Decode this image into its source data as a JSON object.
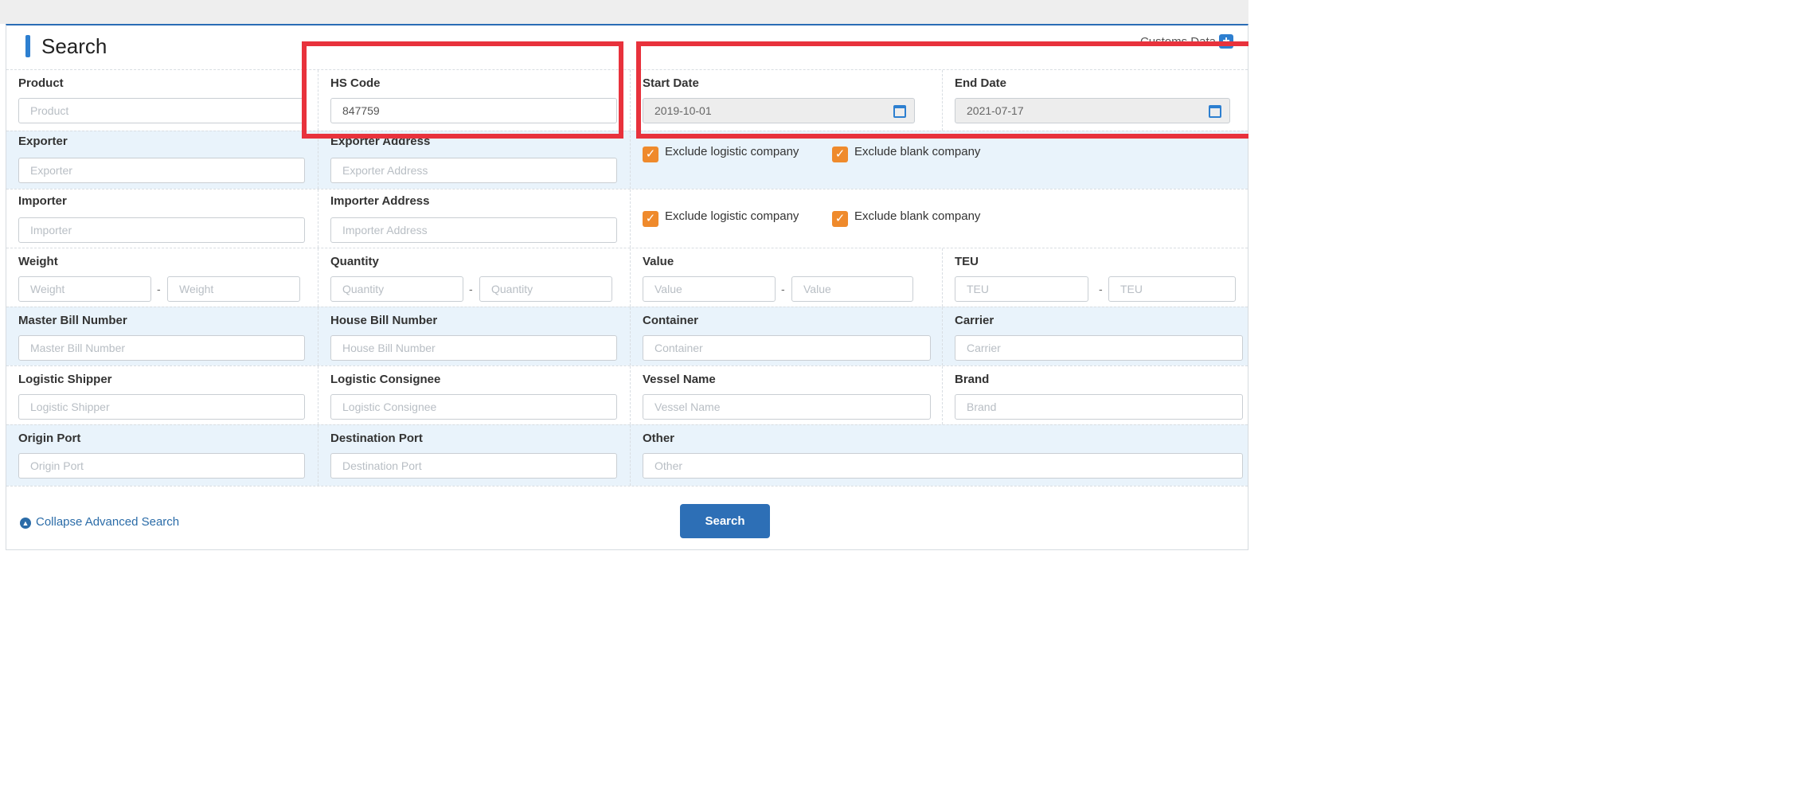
{
  "header": {
    "title": "Search",
    "customs_data": "Customs Data"
  },
  "fields": {
    "product": {
      "label": "Product",
      "placeholder": "Product"
    },
    "hs_code": {
      "label": "HS Code",
      "value": "847759"
    },
    "start_date": {
      "label": "Start Date",
      "value": "2019-10-01"
    },
    "end_date": {
      "label": "End Date",
      "value": "2021-07-17"
    },
    "exporter": {
      "label": "Exporter",
      "placeholder": "Exporter"
    },
    "exporter_address": {
      "label": "Exporter Address",
      "placeholder": "Exporter Address"
    },
    "importer": {
      "label": "Importer",
      "placeholder": "Importer"
    },
    "importer_address": {
      "label": "Importer Address",
      "placeholder": "Importer Address"
    },
    "weight": {
      "label": "Weight",
      "placeholder": "Weight"
    },
    "quantity": {
      "label": "Quantity",
      "placeholder": "Quantity"
    },
    "value": {
      "label": "Value",
      "placeholder": "Value"
    },
    "teu": {
      "label": "TEU",
      "placeholder": "TEU"
    },
    "master_bill": {
      "label": "Master Bill Number",
      "placeholder": "Master Bill Number"
    },
    "house_bill": {
      "label": "House Bill Number",
      "placeholder": "House Bill Number"
    },
    "container": {
      "label": "Container",
      "placeholder": "Container"
    },
    "carrier": {
      "label": "Carrier",
      "placeholder": "Carrier"
    },
    "logistic_shipper": {
      "label": "Logistic Shipper",
      "placeholder": "Logistic Shipper"
    },
    "logistic_consignee": {
      "label": "Logistic Consignee",
      "placeholder": "Logistic Consignee"
    },
    "vessel_name": {
      "label": "Vessel Name",
      "placeholder": "Vessel Name"
    },
    "brand": {
      "label": "Brand",
      "placeholder": "Brand"
    },
    "origin_port": {
      "label": "Origin Port",
      "placeholder": "Origin Port"
    },
    "destination_port": {
      "label": "Destination Port",
      "placeholder": "Destination Port"
    },
    "other": {
      "label": "Other",
      "placeholder": "Other"
    }
  },
  "range_separator": "-",
  "checkboxes": {
    "exclude_logistic": "Exclude logistic company",
    "exclude_blank": "Exclude blank company",
    "exporter_logistic_checked": true,
    "exporter_blank_checked": true,
    "importer_logistic_checked": true,
    "importer_blank_checked": true
  },
  "footer": {
    "collapse_label": "Collapse Advanced Search",
    "search_button": "Search"
  },
  "colors": {
    "accent": "#2d7fd0",
    "checkbox": "#ef8a2c",
    "highlight": "#e8323c",
    "alt_row": "#e9f3fb"
  }
}
